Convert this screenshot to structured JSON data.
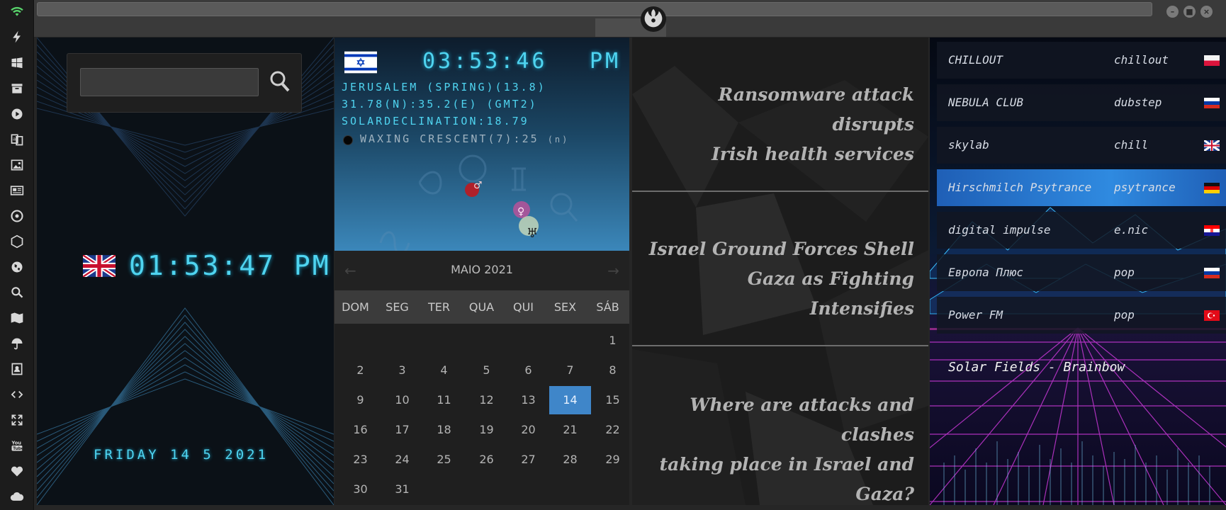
{
  "app": {
    "icons": [
      "wifi-icon",
      "bolt-icon",
      "windows-icon",
      "archive-icon",
      "play-icon",
      "translate-icon",
      "image-icon",
      "newspaper-icon",
      "settings-icon",
      "network-icon",
      "globe-icon",
      "search-icon",
      "map-icon",
      "umbrella-icon",
      "contact-icon",
      "code-icon",
      "expand-icon",
      "youtube-icon",
      "heart-icon",
      "cloud-icon"
    ],
    "accent": "#4fd4f0"
  },
  "clock_uk": {
    "time": "01:53:47 PM",
    "date": "FRIDAY 14 5 2021"
  },
  "clock_il": {
    "time": "03:53:46",
    "ampm": "PM",
    "line1": "JERUSALEM (SPRING)(13.8)",
    "line2": "31.78(N):35.2(E) (GMT2)",
    "line3": "SOLARDECLINATION:18.79",
    "moon": "WAXING CRESCENT(7):25",
    "moon_suffix": "(n)",
    "planets": {
      "mars": "♂",
      "venus": "♀",
      "uranus": "♅"
    }
  },
  "calendar": {
    "prev": "←",
    "next": "→",
    "title": "MAIO 2021",
    "days": [
      "DOM",
      "SEG",
      "TER",
      "QUA",
      "QUI",
      "SEX",
      "SÁB"
    ],
    "dates": [
      "1",
      "2",
      "3",
      "4",
      "5",
      "6",
      "7",
      "8",
      "9",
      "10",
      "11",
      "12",
      "13",
      "14",
      "15",
      "16",
      "17",
      "18",
      "19",
      "20",
      "21",
      "22",
      "23",
      "24",
      "25",
      "26",
      "27",
      "28",
      "29",
      "30",
      "31"
    ],
    "today": "14"
  },
  "news": [
    {
      "line1": "Ransomware attack disrupts",
      "line2": "Irish health services"
    },
    {
      "line1": "Israel Ground Forces Shell",
      "line2": "Gaza as Fighting Intensifies"
    },
    {
      "line1": "Where are attacks and clashes",
      "line2": "taking place in Israel and Gaza?"
    }
  ],
  "radio": {
    "stations": [
      {
        "name": "CHILLOUT",
        "genre": "chillout",
        "flag": "poland"
      },
      {
        "name": "NEBULA CLUB",
        "genre": "dubstep",
        "flag": "russia"
      },
      {
        "name": "skylab",
        "genre": "chill",
        "flag": "uk"
      },
      {
        "name": "Hirschmilch Psytrance",
        "genre": "psytrance",
        "flag": "germany"
      },
      {
        "name": "digital impulse",
        "genre": "e.nic",
        "flag": "croatia"
      },
      {
        "name": "Европа Плюс",
        "genre": "pop",
        "flag": "russia"
      },
      {
        "name": "Power FM",
        "genre": "pop",
        "flag": "turkey"
      }
    ],
    "active_index": 3,
    "now_playing": "Solar Fields - Brainbow"
  }
}
